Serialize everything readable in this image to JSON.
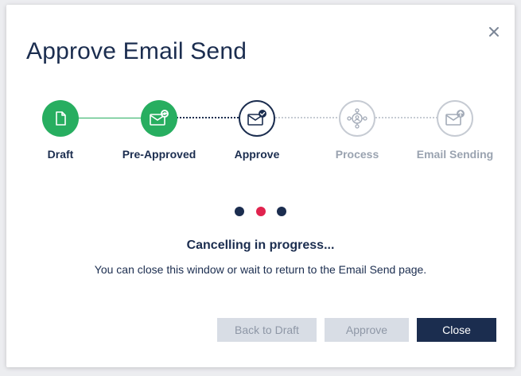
{
  "dialog": {
    "title": "Approve Email Send"
  },
  "stepper": {
    "steps": [
      {
        "label": "Draft",
        "state": "done",
        "icon": "document-icon"
      },
      {
        "label": "Pre-Approved",
        "state": "done",
        "icon": "envelope-refresh-icon"
      },
      {
        "label": "Approve",
        "state": "active",
        "icon": "envelope-check-icon"
      },
      {
        "label": "Process",
        "state": "pending",
        "icon": "process-network-icon"
      },
      {
        "label": "Email Sending",
        "state": "pending",
        "icon": "envelope-upload-icon"
      }
    ]
  },
  "status": {
    "title": "Cancelling in progress...",
    "message": "You can close this window or wait to return to the Email Send page."
  },
  "buttons": {
    "back_to_draft": "Back to Draft",
    "approve": "Approve",
    "close": "Close"
  },
  "colors": {
    "primary": "#1b2d4f",
    "success": "#27ae60",
    "accent": "#e0234e",
    "muted": "#c6cbd3"
  }
}
